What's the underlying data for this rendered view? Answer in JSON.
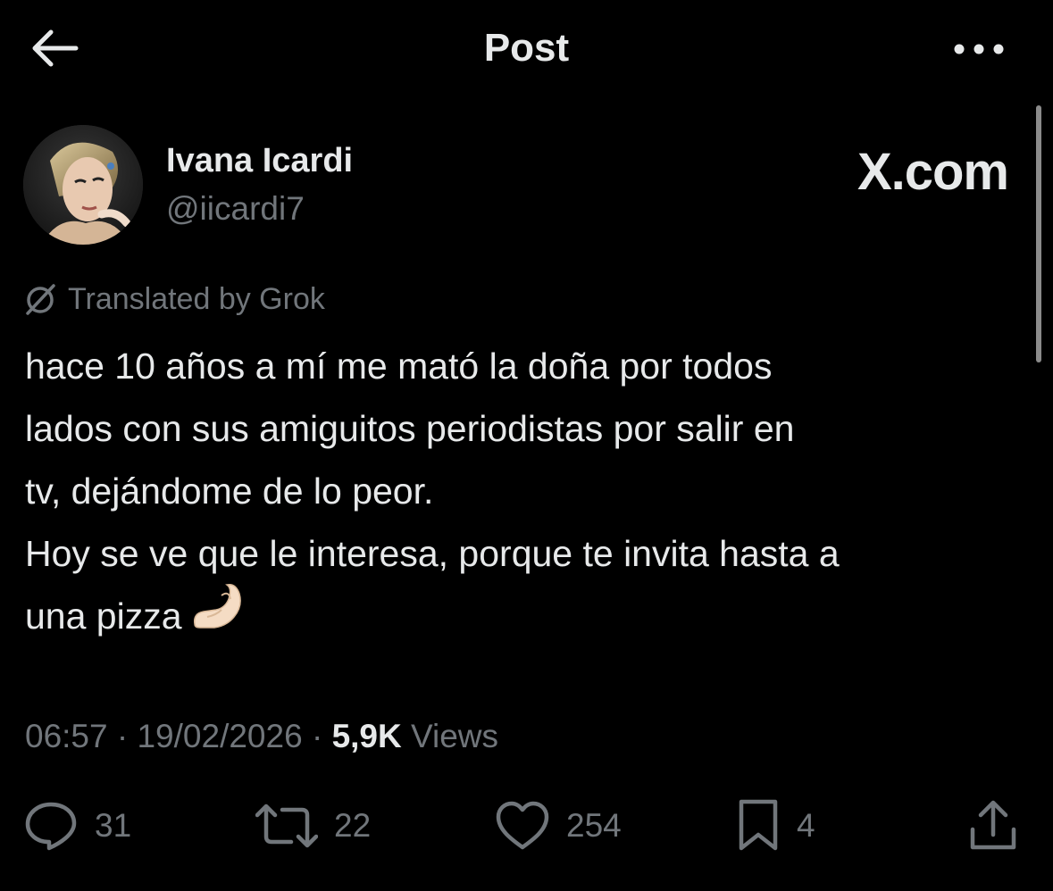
{
  "header": {
    "title": "Post",
    "back_icon": "arrow-left-icon",
    "more_icon": "more-horizontal-icon"
  },
  "author": {
    "name": "Ivana Icardi",
    "handle": "@iicardi7",
    "avatar_icon": "avatar"
  },
  "watermark": "X.com",
  "translation": {
    "label": "Translated by Grok",
    "icon": "grok-icon"
  },
  "post": {
    "lines": [
      "hace 10 años a mí me mató la doña por todos",
      "lados con sus amiguitos periodistas por salir en",
      "tv, dejándome de lo peor.",
      "Hoy se ve que le interesa, porque te invita hasta a",
      "una pizza"
    ],
    "emoji": "🤌🏻"
  },
  "meta": {
    "time": "06:57",
    "separator": "·",
    "date": "19/02/2026",
    "views_count": "5,9K",
    "views_label": "Views"
  },
  "actions": {
    "replies": "31",
    "reposts": "22",
    "likes": "254",
    "bookmarks": "4"
  },
  "colors": {
    "background": "#000000",
    "primary_text": "#e7e9ea",
    "secondary_text": "#71767b"
  }
}
